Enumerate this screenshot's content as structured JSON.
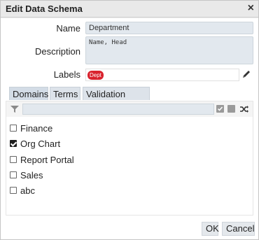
{
  "dialog": {
    "title": "Edit Data Schema",
    "close_label": "×"
  },
  "form": {
    "name_label": "Name",
    "name_value": "Department",
    "description_label": "Description",
    "description_value": "Name, Head",
    "labels_label": "Labels",
    "labels_badge": "Dept",
    "badge_color": "#d9232e"
  },
  "tabs": [
    {
      "label": "Domains",
      "active": true
    },
    {
      "label": "Terms",
      "active": false
    },
    {
      "label": "Validation Rules",
      "active": false
    }
  ],
  "domains": [
    {
      "label": "Finance",
      "checked": false
    },
    {
      "label": "Org Chart",
      "checked": true
    },
    {
      "label": "Report Portal",
      "checked": false
    },
    {
      "label": "Sales",
      "checked": false
    },
    {
      "label": "abc",
      "checked": false
    }
  ],
  "filter": {
    "placeholder": ""
  },
  "buttons": {
    "ok": "OK",
    "cancel": "Cancel"
  },
  "icons": {
    "close": "close-icon",
    "edit": "pencil-icon",
    "filter": "filter-icon",
    "select_all": "check-square-icon",
    "deselect": "square-icon",
    "shuffle": "shuffle-icon"
  }
}
